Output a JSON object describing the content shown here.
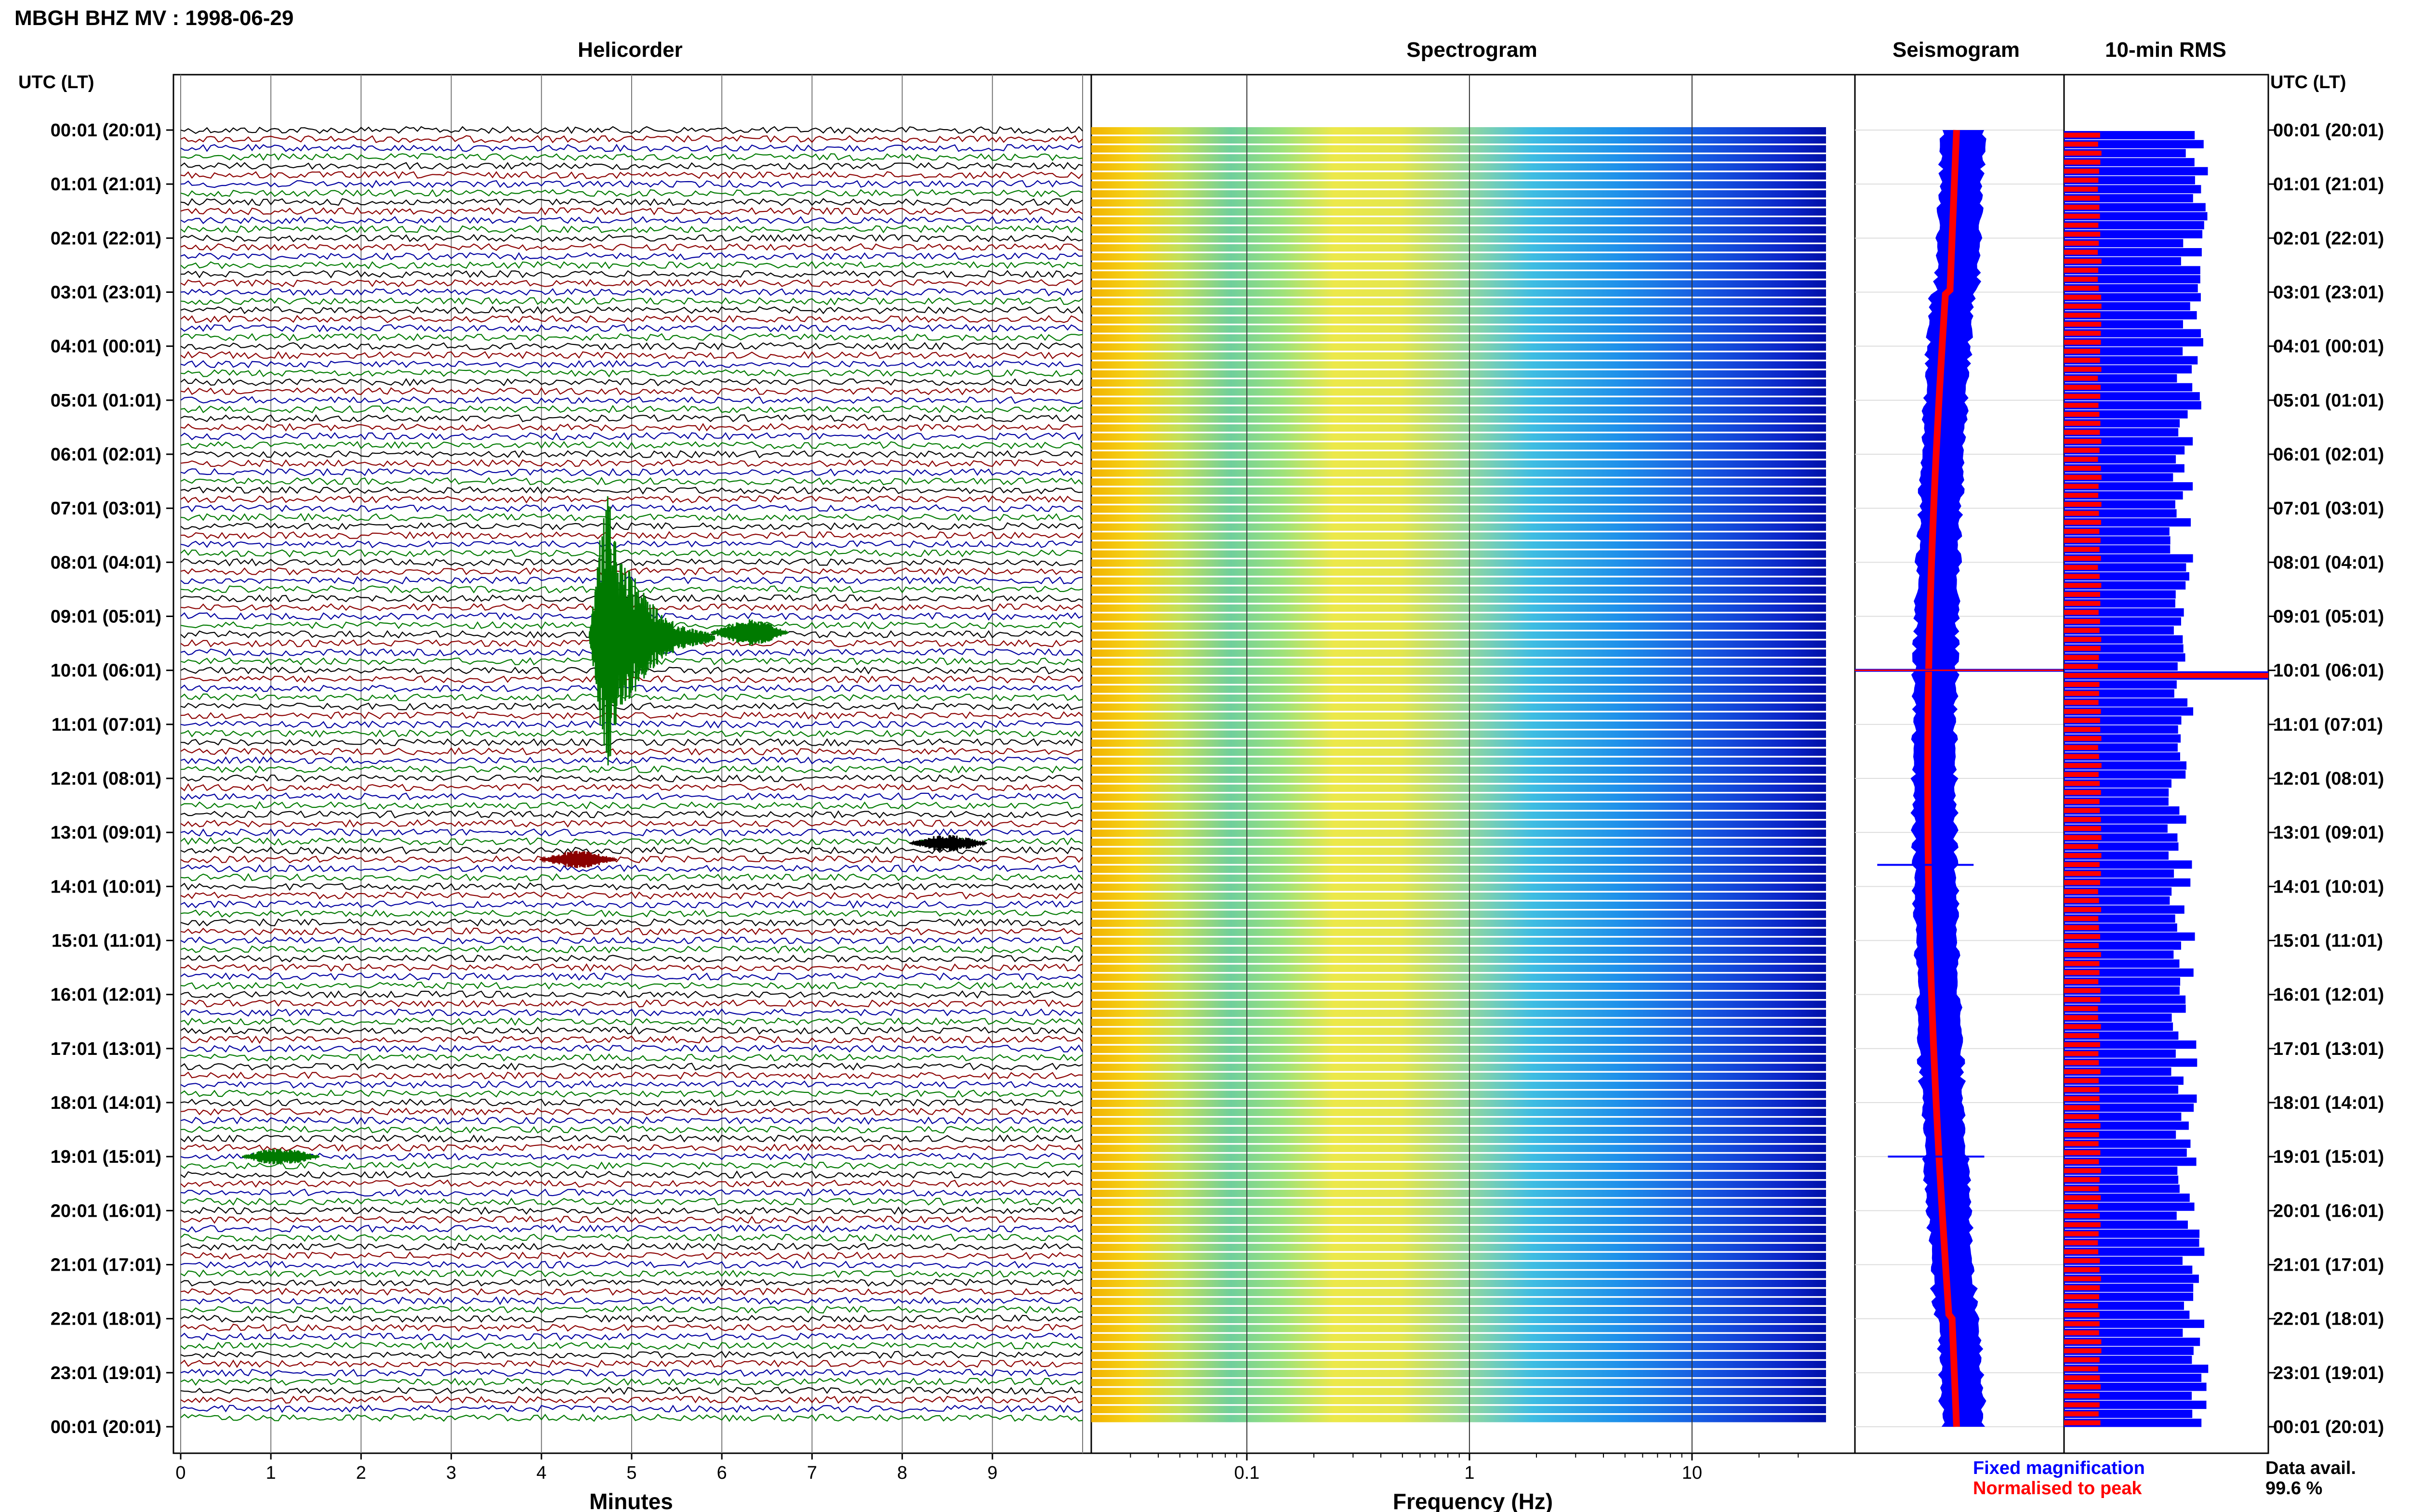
{
  "header": {
    "station_title": "MBGH BHZ MV : 1998-06-29"
  },
  "panels": {
    "helicorder_title": "Helicorder",
    "spectrogram_title": "Spectrogram",
    "seismogram_title": "Seismogram",
    "rms_title": "10-min RMS"
  },
  "axis_labels": {
    "time_axis_header_left": "UTC (LT)",
    "time_axis_header_right": "UTC (LT)",
    "helicorder_xlabel": "Minutes",
    "spectrogram_xlabel": "Frequency (Hz)"
  },
  "legend": {
    "fixed_magnification": "Fixed magnification",
    "normalised_to_peak": "Normalised to peak",
    "data_avail_label": "Data avail.",
    "data_avail_value": "99.6 %"
  },
  "colors": {
    "trace_black": "#000000",
    "trace_red": "#8b0000",
    "trace_blue": "#0000a0",
    "trace_green": "#007a00",
    "seismo_blue": "#0000ff",
    "seismo_red": "#ff0000",
    "rms_blue": "#0000ff",
    "rms_red": "#ff0000"
  },
  "chart_data": [
    {
      "type": "line",
      "panel": "Helicorder",
      "xlabel": "Minutes",
      "xlim": [
        0,
        10
      ],
      "x_ticks": [
        "0",
        "1",
        "2",
        "3",
        "4",
        "5",
        "6",
        "7",
        "8",
        "9"
      ],
      "row_count": 144,
      "row_colors_cycle": [
        "black",
        "red",
        "blue",
        "green"
      ],
      "y_tick_labels": [
        "00:01 (20:01)",
        "01:01 (21:01)",
        "02:01 (22:01)",
        "03:01 (23:01)",
        "04:01 (00:01)",
        "05:01 (01:01)",
        "06:01 (02:01)",
        "07:01 (03:01)",
        "08:01 (04:01)",
        "09:01 (05:01)",
        "10:01 (06:01)",
        "11:01 (07:01)",
        "12:01 (08:01)",
        "13:01 (09:01)",
        "14:01 (10:01)",
        "15:01 (11:01)",
        "16:01 (12:01)",
        "17:01 (13:01)",
        "18:01 (14:01)",
        "19:01 (15:01)",
        "20:01 (16:01)",
        "21:01 (17:01)",
        "22:01 (18:01)",
        "23:01 (19:01)",
        "00:01 (20:01)"
      ],
      "events": [
        {
          "utc_hour": 9.4,
          "minute": 4.9,
          "amplitude": "large",
          "color": "green"
        },
        {
          "utc_hour": 9.3,
          "minute": 6.2,
          "amplitude": "medium",
          "color": "green"
        },
        {
          "utc_hour": 13.2,
          "minute": 8.4,
          "amplitude": "small",
          "color": "black"
        },
        {
          "utc_hour": 13.5,
          "minute": 4.3,
          "amplitude": "small",
          "color": "red"
        },
        {
          "utc_hour": 19.0,
          "minute": 1.0,
          "amplitude": "small",
          "color": "green"
        }
      ]
    },
    {
      "type": "heatmap",
      "panel": "Spectrogram",
      "xlabel": "Frequency (Hz)",
      "x_scale": "log",
      "xlim": [
        0.02,
        40
      ],
      "x_tick_labels": [
        "0.1",
        "1",
        "10"
      ],
      "x_ticks": [
        0.1,
        1,
        10
      ],
      "rows": 144
    },
    {
      "type": "line",
      "panel": "Seismogram",
      "series": [
        {
          "name": "Fixed magnification",
          "color": "blue"
        },
        {
          "name": "Normalised to peak",
          "color": "red"
        }
      ],
      "spike_hours": [
        10.0,
        13.6,
        19.0
      ]
    },
    {
      "type": "bar",
      "panel": "10-min RMS",
      "orientation": "horizontal",
      "rows": 144,
      "series": [
        {
          "name": "Fixed magnification",
          "color": "blue"
        },
        {
          "name": "Normalised to peak",
          "color": "red"
        }
      ],
      "peak_hour": 10.0
    }
  ]
}
